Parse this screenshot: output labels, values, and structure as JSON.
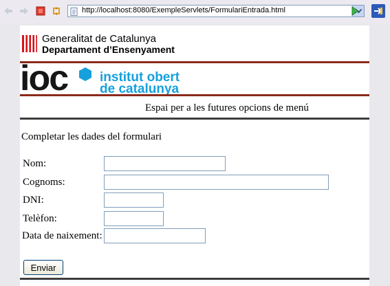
{
  "browser": {
    "url": "http://localhost:8080/ExempleServlets/FormulariEntrada.html",
    "icons": [
      "back-arrow-icon",
      "forward-arrow-icon",
      "stop-icon",
      "reload-icon",
      "page-icon",
      "dropdown-icon",
      "go-icon",
      "extension-icon"
    ]
  },
  "header": {
    "gen_line1": "Generalitat de Catalunya",
    "gen_line2": "Departament d’Ensenyament",
    "ioc_logo": "ioc",
    "ioc_name_line1": "institut obert",
    "ioc_name_line2": "de catalunya"
  },
  "menu": {
    "text": "Espai per a les futures opcions de menú"
  },
  "form": {
    "title": "Completar les dades del formulari",
    "fields": [
      {
        "label": "Nom:",
        "value": ""
      },
      {
        "label": "Cognoms:",
        "value": ""
      },
      {
        "label": "DNI:",
        "value": ""
      },
      {
        "label": "Telèfon:",
        "value": ""
      },
      {
        "label": "Data de naixement:",
        "value": ""
      }
    ],
    "submit_label": "Enviar"
  },
  "colors": {
    "accent_red": "#8b2a1a",
    "ioc_blue": "#16a0dc",
    "dark_rule": "#3d3d3d"
  }
}
